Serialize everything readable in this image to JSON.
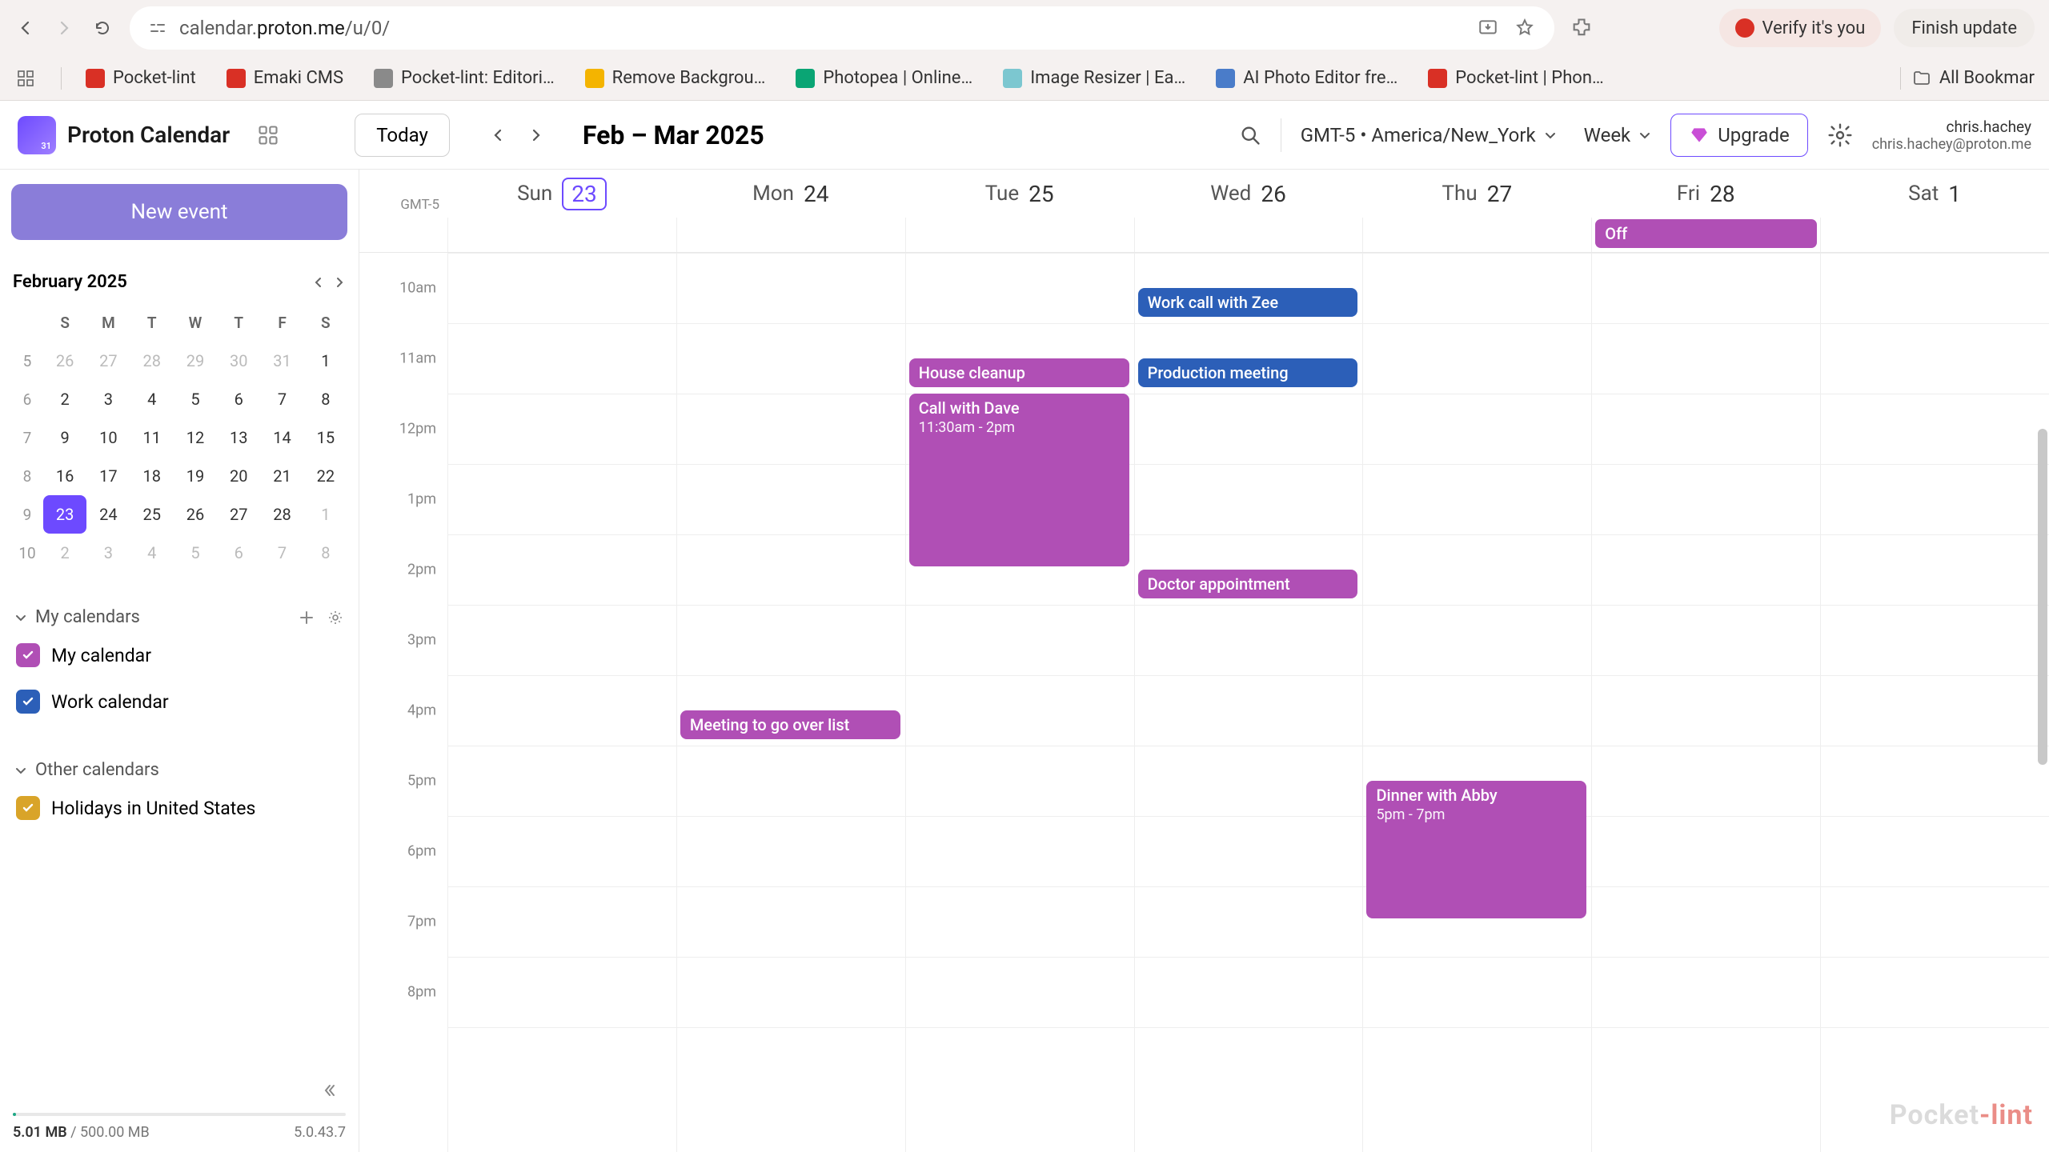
{
  "browser": {
    "url_prefix": "calendar.",
    "url_domain": "proton.me",
    "url_path": "/u/0/",
    "verify_label": "Verify it's you",
    "finish_label": "Finish update",
    "bookmarks": [
      {
        "label": "Pocket-lint",
        "color": "#d93025"
      },
      {
        "label": "Emaki CMS",
        "color": "#d93025"
      },
      {
        "label": "Pocket-lint: Editori…",
        "color": "#8a8a8a"
      },
      {
        "label": "Remove Backgrou…",
        "color": "#f4b400"
      },
      {
        "label": "Photopea | Online…",
        "color": "#0aa574"
      },
      {
        "label": "Image Resizer | Ea…",
        "color": "#7cc7d0"
      },
      {
        "label": "AI Photo Editor fre…",
        "color": "#4a7cc9"
      },
      {
        "label": "Pocket-lint | Phon…",
        "color": "#d93025"
      }
    ],
    "all_bookmarks_label": "All Bookmar"
  },
  "header": {
    "logo_text": "Proton Calendar",
    "today_label": "Today",
    "date_range": "Feb – Mar 2025",
    "timezone": "GMT-5 • America/New_York",
    "view_label": "Week",
    "upgrade_label": "Upgrade",
    "user_name": "chris.hachey",
    "user_email": "chris.hachey@proton.me"
  },
  "sidebar": {
    "new_event_label": "New event",
    "mini_month_label": "February 2025",
    "dow": [
      "S",
      "M",
      "T",
      "W",
      "T",
      "F",
      "S"
    ],
    "weeks": [
      {
        "wk": "5",
        "days": [
          {
            "d": "26",
            "o": true
          },
          {
            "d": "27",
            "o": true
          },
          {
            "d": "28",
            "o": true
          },
          {
            "d": "29",
            "o": true
          },
          {
            "d": "30",
            "o": true
          },
          {
            "d": "31",
            "o": true
          },
          {
            "d": "1"
          }
        ]
      },
      {
        "wk": "6",
        "days": [
          {
            "d": "2"
          },
          {
            "d": "3"
          },
          {
            "d": "4"
          },
          {
            "d": "5"
          },
          {
            "d": "6"
          },
          {
            "d": "7"
          },
          {
            "d": "8"
          }
        ]
      },
      {
        "wk": "7",
        "days": [
          {
            "d": "9"
          },
          {
            "d": "10"
          },
          {
            "d": "11"
          },
          {
            "d": "12"
          },
          {
            "d": "13"
          },
          {
            "d": "14"
          },
          {
            "d": "15"
          }
        ]
      },
      {
        "wk": "8",
        "days": [
          {
            "d": "16"
          },
          {
            "d": "17"
          },
          {
            "d": "18"
          },
          {
            "d": "19"
          },
          {
            "d": "20"
          },
          {
            "d": "21"
          },
          {
            "d": "22"
          }
        ]
      },
      {
        "wk": "9",
        "days": [
          {
            "d": "23",
            "today": true
          },
          {
            "d": "24"
          },
          {
            "d": "25"
          },
          {
            "d": "26"
          },
          {
            "d": "27"
          },
          {
            "d": "28"
          },
          {
            "d": "1",
            "o": true
          }
        ]
      },
      {
        "wk": "10",
        "days": [
          {
            "d": "2",
            "o": true
          },
          {
            "d": "3",
            "o": true
          },
          {
            "d": "4",
            "o": true
          },
          {
            "d": "5",
            "o": true
          },
          {
            "d": "6",
            "o": true
          },
          {
            "d": "7",
            "o": true
          },
          {
            "d": "8",
            "o": true
          }
        ]
      }
    ],
    "my_calendars_label": "My calendars",
    "my_calendars": [
      {
        "label": "My calendar",
        "color": "#b04fb5"
      },
      {
        "label": "Work calendar",
        "color": "#2c5fb8"
      }
    ],
    "other_calendars_label": "Other calendars",
    "other_calendars": [
      {
        "label": "Holidays in United States",
        "color": "#d9a429"
      }
    ],
    "storage_used": "5.01 MB",
    "storage_sep": " / ",
    "storage_total": "500.00 MB",
    "version": "5.0.43.7"
  },
  "grid": {
    "tz_label": "GMT-5",
    "days": [
      {
        "dow": "Sun",
        "num": "23",
        "today": true
      },
      {
        "dow": "Mon",
        "num": "24"
      },
      {
        "dow": "Tue",
        "num": "25"
      },
      {
        "dow": "Wed",
        "num": "26"
      },
      {
        "dow": "Thu",
        "num": "27"
      },
      {
        "dow": "Fri",
        "num": "28"
      },
      {
        "dow": "Sat",
        "num": "1"
      }
    ],
    "allday": {
      "fri_label": "Off"
    },
    "hours": [
      "10am",
      "11am",
      "12pm",
      "1pm",
      "2pm",
      "3pm",
      "4pm",
      "5pm",
      "6pm",
      "7pm",
      "8pm"
    ],
    "hour_height": 88,
    "events": {
      "mon_meeting": "Meeting to go over list",
      "tue_house": "House cleanup",
      "tue_call_title": "Call with Dave",
      "tue_call_time": "11:30am - 2pm",
      "wed_work": "Work call with Zee",
      "wed_prod": "Production meeting",
      "wed_doc": "Doctor appointment",
      "thu_dinner_title": "Dinner with Abby",
      "thu_dinner_time": "5pm - 7pm"
    }
  },
  "watermark": {
    "a": "Pocket",
    "b": "-lint"
  }
}
